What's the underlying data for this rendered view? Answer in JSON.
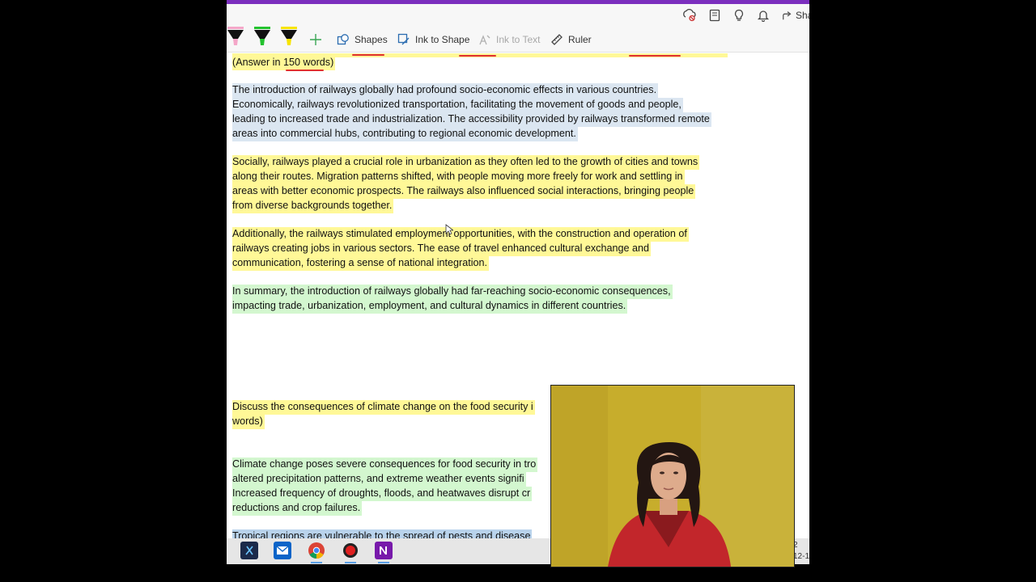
{
  "topbar": {
    "icons": [
      "sync-icon",
      "notebook-icon",
      "lightbulb-icon",
      "bell-icon"
    ],
    "share_label": "Sha"
  },
  "ribbon": {
    "pens": [
      {
        "name": "pink-highlighter",
        "color": "#f4a6c8"
      },
      {
        "name": "green-highlighter",
        "color": "#22c22e"
      },
      {
        "name": "yellow-highlighter",
        "color": "#f7e400"
      }
    ],
    "shapes_label": "Shapes",
    "ink_to_shape_label": "Ink to Shape",
    "ink_to_text_label": "Ink to Text",
    "ruler_label": "Ruler"
  },
  "document": {
    "q1_answer_note": "(Answer in 150 words)",
    "p1_lines": [
      "The introduction of railways globally had profound socio-economic effects in various countries.",
      "Economically, railways revolutionized transportation, facilitating the movement of goods and people,",
      "leading to increased trade and industrialization. The accessibility provided by railways transformed remote",
      "areas into commercial hubs, contributing to regional economic development."
    ],
    "p2_lines": [
      "Socially, railways played a crucial role in urbanization as they often led to the growth of cities and towns",
      "along their routes. Migration patterns shifted, with people moving more freely for work and settling in",
      "areas with better economic prospects. The railways also influenced social interactions, bringing people",
      "from diverse backgrounds together."
    ],
    "p3_lines": [
      "Additionally, the railways stimulated employment opportunities, with the construction and operation of",
      "railways creating jobs in various sectors. The ease of travel enhanced cultural exchange and",
      "communication, fostering a sense of national integration."
    ],
    "p4_lines": [
      "In summary, the introduction of railways globally had far-reaching socio-economic consequences,",
      "impacting trade, urbanization, employment, and cultural dynamics in different countries."
    ],
    "q2_lines": [
      "Discuss the consequences of climate change on the food security i",
      "words)"
    ],
    "p5_lines": [
      "Climate change poses severe consequences for food security in tro",
      "altered precipitation patterns, and extreme weather events signifi",
      "Increased frequency of droughts, floods, and heatwaves disrupt cr",
      "reductions and crop failures."
    ],
    "p6_partial": "Tropical regions are vulnerable to the spread of pests and disease"
  },
  "taskbar": {
    "apps": [
      "snipping-tool",
      "mail",
      "chrome",
      "screen-recorder",
      "onenote"
    ],
    "clock_line1": "2",
    "clock_line2": "12-1"
  },
  "colors": {
    "accent_purple": "#7b2fbe",
    "highlight_blue": "#dbe6f1",
    "highlight_yellow": "#fff897",
    "highlight_green": "#d3f7cf",
    "ink_red": "#e0302e"
  }
}
